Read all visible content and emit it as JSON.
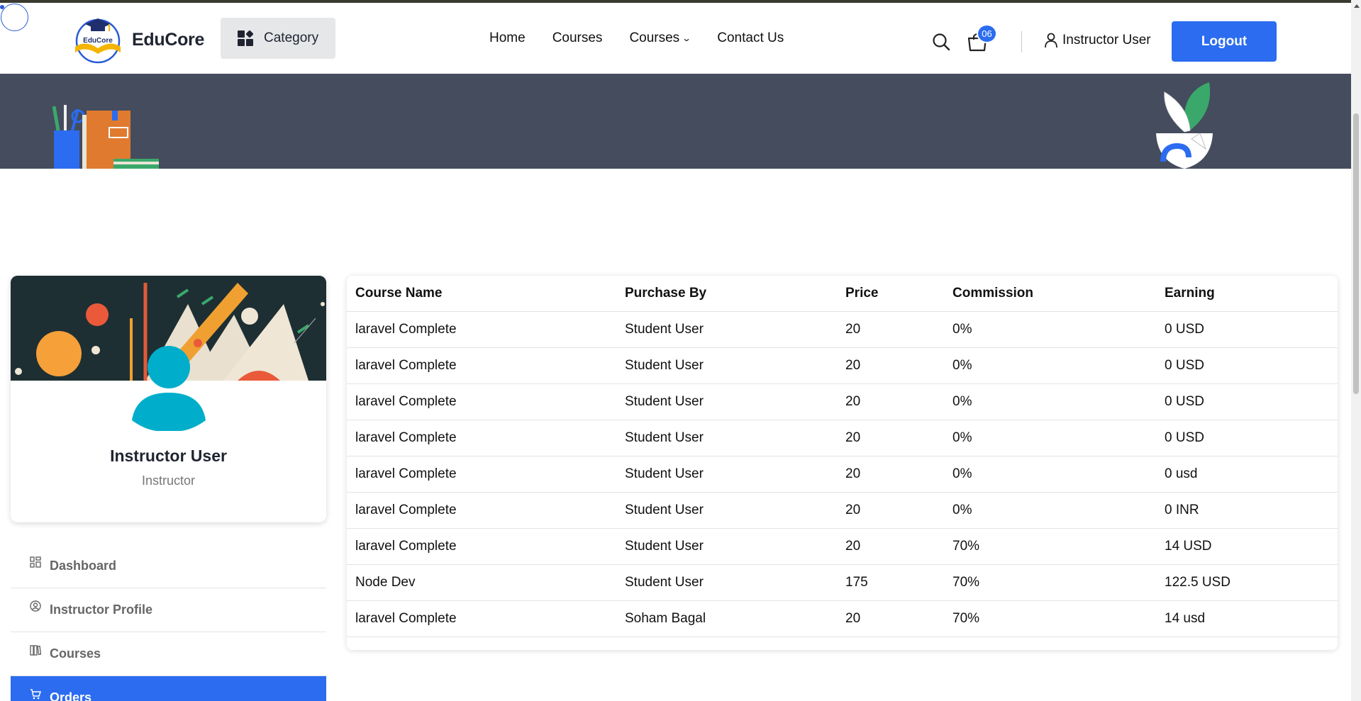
{
  "brand": {
    "name": "EduCore",
    "mark_text": "EduCore"
  },
  "header": {
    "category_label": "Category",
    "nav": [
      {
        "label": "Home",
        "dropdown": false
      },
      {
        "label": "Courses",
        "dropdown": false
      },
      {
        "label": "Courses",
        "dropdown": true
      },
      {
        "label": "Contact Us",
        "dropdown": false
      }
    ],
    "cart_count": "06",
    "user_label": "Instructor User",
    "logout_label": "Logout"
  },
  "profile": {
    "name": "Instructor User",
    "role": "Instructor"
  },
  "sidebar": {
    "items": [
      {
        "label": "Dashboard",
        "icon": "dashboard-icon",
        "active": false
      },
      {
        "label": "Instructor Profile",
        "icon": "user-circle-icon",
        "active": false
      },
      {
        "label": "Courses",
        "icon": "books-icon",
        "active": false
      },
      {
        "label": "Orders",
        "icon": "cart-icon",
        "active": true
      }
    ]
  },
  "orders_table": {
    "headers": [
      "Course Name",
      "Purchase By",
      "Price",
      "Commission",
      "Earning"
    ],
    "rows": [
      [
        "laravel Complete",
        "Student User",
        "20",
        "0%",
        "0 USD"
      ],
      [
        "laravel Complete",
        "Student User",
        "20",
        "0%",
        "0 USD"
      ],
      [
        "laravel Complete",
        "Student User",
        "20",
        "0%",
        "0 USD"
      ],
      [
        "laravel Complete",
        "Student User",
        "20",
        "0%",
        "0 USD"
      ],
      [
        "laravel Complete",
        "Student User",
        "20",
        "0%",
        "0 usd"
      ],
      [
        "laravel Complete",
        "Student User",
        "20",
        "0%",
        "0 INR"
      ],
      [
        "laravel Complete",
        "Student User",
        "20",
        "70%",
        "14 USD"
      ],
      [
        "Node Dev",
        "Student User",
        "175",
        "70%",
        "122.5 USD"
      ],
      [
        "laravel Complete",
        "Soham Bagal",
        "20",
        "70%",
        "14 usd"
      ]
    ]
  },
  "colors": {
    "primary": "#2b6cf0",
    "banner": "#444c5d",
    "avatar": "#00aecb"
  }
}
